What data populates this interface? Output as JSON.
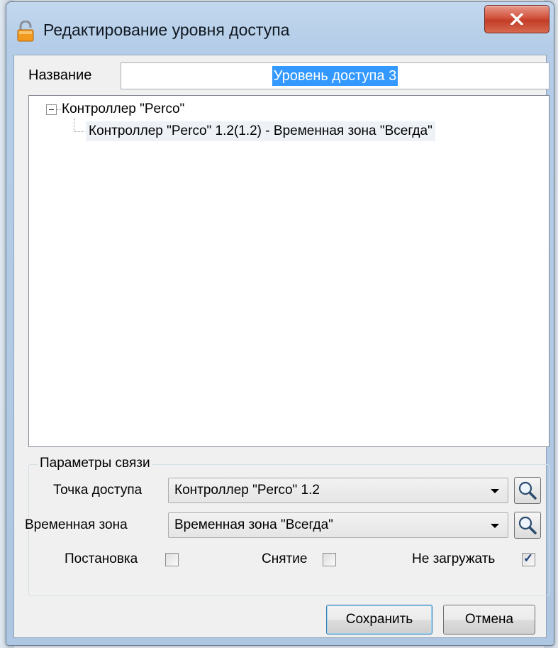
{
  "window": {
    "title": "Редактирование уровня доступа",
    "close_glyph": "X"
  },
  "name_field": {
    "label": "Название",
    "value": "Уровень доступа 3"
  },
  "tree": {
    "root": "Контроллер \"Perco\"",
    "child": "Контроллер \"Perco\" 1.2(1.2) - Временная зона \"Всегда\""
  },
  "link_params": {
    "caption": "Параметры связи",
    "access_point": {
      "label": "Точка доступа",
      "value": "Контроллер \"Perco\" 1.2"
    },
    "time_zone": {
      "label": "Временная зона",
      "value": "Временная зона \"Всегда\""
    },
    "checkboxes": [
      {
        "label": "Постановка",
        "checked": false
      },
      {
        "label": "Снятие",
        "checked": false
      },
      {
        "label": "Не загружать",
        "checked": true
      }
    ]
  },
  "buttons": {
    "save": "Сохранить",
    "cancel": "Отмена"
  },
  "icons": {
    "title": "lock-icon",
    "search": "magnifier-icon",
    "dropdown": "chevron-down-icon"
  }
}
